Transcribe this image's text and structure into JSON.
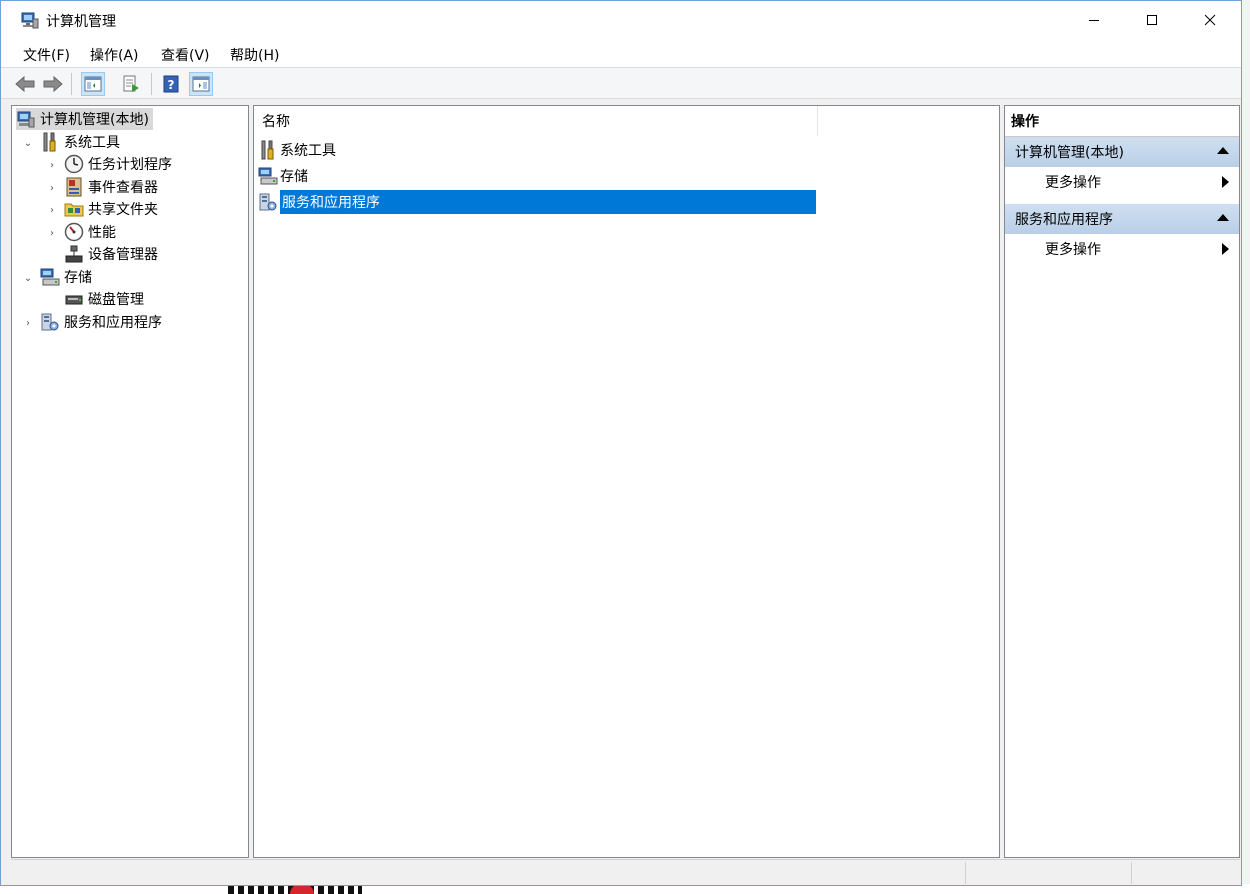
{
  "window": {
    "title": "计算机管理"
  },
  "menu": [
    "文件(F)",
    "操作(A)",
    "查看(V)",
    "帮助(H)"
  ],
  "toolbar": {
    "buttons": [
      "back-arrow-icon",
      "forward-arrow-icon",
      "show-hide-console-tree-icon",
      "export-list-icon",
      "help-icon",
      "show-hide-action-pane-icon"
    ]
  },
  "tree": {
    "root": "计算机管理(本地)",
    "system_tools": "系统工具",
    "task_scheduler": "任务计划程序",
    "event_viewer": "事件查看器",
    "shared_folders": "共享文件夹",
    "performance": "性能",
    "device_manager": "设备管理器",
    "storage": "存储",
    "disk_management": "磁盘管理",
    "services_apps": "服务和应用程序"
  },
  "list": {
    "column_name": "名称",
    "rows": [
      "系统工具",
      "存储",
      "服务和应用程序"
    ],
    "selected_index": 2
  },
  "actions": {
    "header": "操作",
    "group1": "计算机管理(本地)",
    "group1_more": "更多操作",
    "group2": "服务和应用程序",
    "group2_more": "更多操作"
  },
  "colors": {
    "selection": "#0078d7",
    "action_group": "#c4d8ee"
  }
}
